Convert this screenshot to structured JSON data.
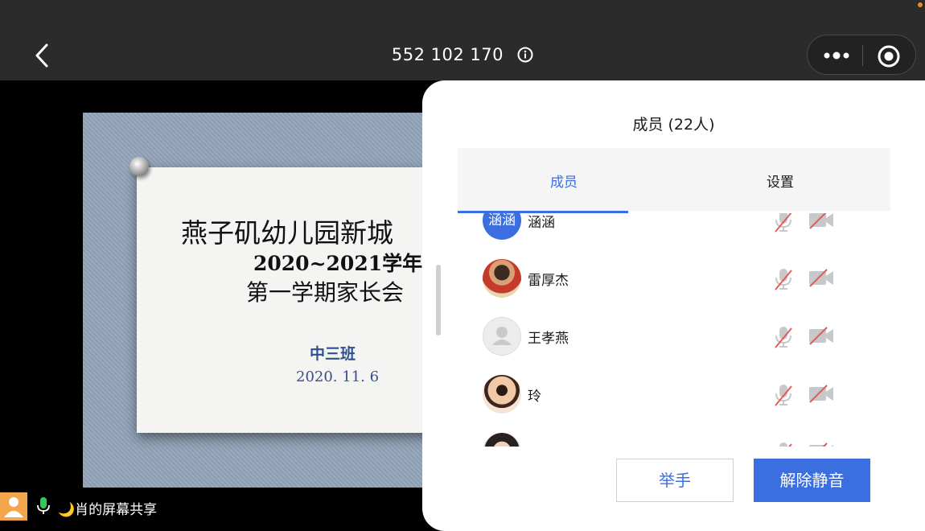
{
  "topbar": {
    "meeting_id": "552 102 170",
    "back_icon": "chevron-left-icon",
    "info_icon": "info-icon",
    "more_icon": "more-dots-icon",
    "record_icon": "record-icon"
  },
  "slide": {
    "line1": "燕子矶幼儿园新城",
    "line2": "2020~2021学年",
    "line3": "第一学期家长会",
    "class_name": "中三班",
    "date": "2020. 11. 6"
  },
  "share_bar": {
    "text": "🌙肖的屏幕共享",
    "mic_status": "on"
  },
  "panel": {
    "title": "成员 (22人)",
    "tabs": [
      {
        "label": "成员",
        "active": true
      },
      {
        "label": "设置",
        "active": false
      }
    ],
    "members": [
      {
        "name": "涵涵",
        "avatar_type": "text",
        "avatar_text": "涵涵",
        "mic": "off",
        "camera": "off"
      },
      {
        "name": "雷厚杰",
        "avatar_type": "photo",
        "avatar_text": "",
        "mic": "off",
        "camera": "off"
      },
      {
        "name": "王孝燕",
        "avatar_type": "default",
        "avatar_text": "",
        "mic": "off",
        "camera": "off"
      },
      {
        "name": "玲",
        "avatar_type": "photo",
        "avatar_text": "",
        "mic": "off",
        "camera": "off"
      },
      {
        "name": "",
        "avatar_type": "photo",
        "avatar_text": "",
        "mic": "off",
        "camera": "off"
      }
    ],
    "raise_hand_label": "举手",
    "unmute_label": "解除静音"
  },
  "colors": {
    "accent": "#3b6fe0",
    "topbar_bg": "#2b2b2b",
    "muted_red": "#e45a5a",
    "share_tile": "#f3a64c",
    "mic_green": "#35c759"
  }
}
